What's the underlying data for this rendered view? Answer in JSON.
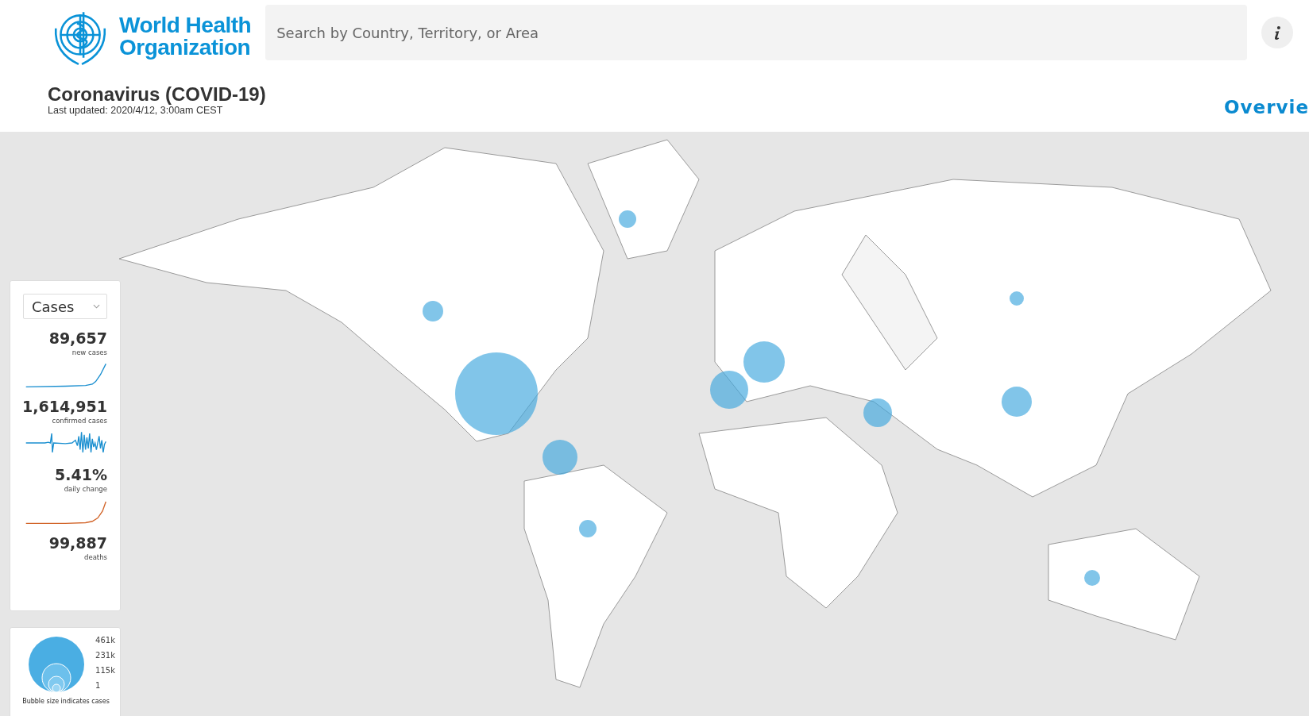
{
  "logo": {
    "line_1": "World Health",
    "line_2": "Organization"
  },
  "search": {
    "placeholder": "Search by Country, Territory, or Area"
  },
  "title": "Coronavirus (COVID-19)",
  "updated": "Last updated: 2020/4/12, 3:00am CEST",
  "nav_link": "Overvie",
  "panel": {
    "dropdown": "Cases",
    "stats": [
      {
        "value": "89,657",
        "label": "new cases"
      },
      {
        "value": "1,614,951",
        "label": "confirmed cases"
      },
      {
        "value": "5.41%",
        "label": "daily change"
      },
      {
        "value": "99,887",
        "label": "deaths"
      }
    ]
  },
  "legend": {
    "sizes": [
      "461k",
      "231k",
      "115k",
      "1"
    ],
    "caption": "Bubble size indicates cases"
  }
}
